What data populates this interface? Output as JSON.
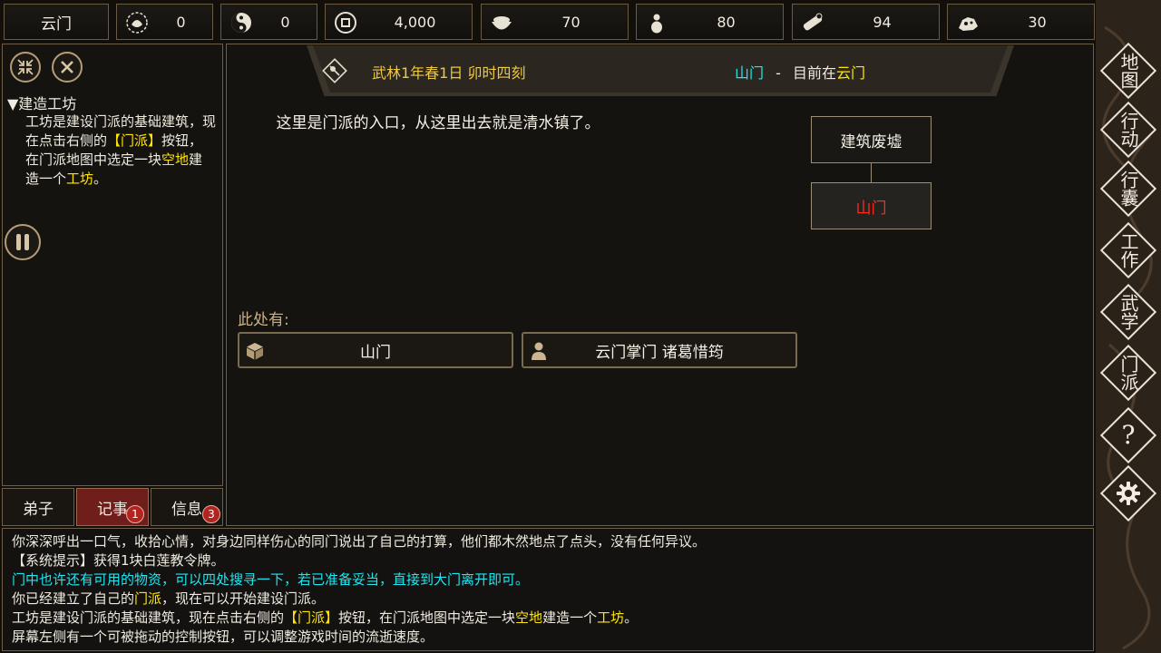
{
  "topbar": {
    "location_name": "云门",
    "resources": [
      {
        "icon": "reputation-icon",
        "value": "0"
      },
      {
        "icon": "yin-yang-icon",
        "value": "0"
      },
      {
        "icon": "coin-icon",
        "value": "4,000"
      },
      {
        "icon": "food-bowl-icon",
        "value": "70"
      },
      {
        "icon": "gourd-icon",
        "value": "80"
      },
      {
        "icon": "wood-log-icon",
        "value": "94"
      },
      {
        "icon": "ore-icon",
        "value": "30"
      }
    ]
  },
  "left_panel": {
    "quest_title": "▼建造工坊",
    "quest_text_parts": [
      "工坊是建设门派的基础建筑，现在点击右侧的",
      "【门派】",
      "按钮，在门派地图中选定一块",
      "空地",
      "建造一个",
      "工坊",
      "。"
    ],
    "tabs": [
      {
        "label": "弟子",
        "badge": ""
      },
      {
        "label": "记事",
        "badge": "1"
      },
      {
        "label": "信息",
        "badge": "3"
      }
    ]
  },
  "header": {
    "date": "武林1年春1日 卯时四刻",
    "place": "山门",
    "separator": "-",
    "current_prefix": "目前在",
    "current_location": "云门"
  },
  "main": {
    "description": "这里是门派的入口，从这里出去就是清水镇了。",
    "map_nodes": [
      {
        "label": "建筑废墟",
        "color": "#f5f0e6"
      },
      {
        "label": "山门",
        "color": "#ff2a1f"
      }
    ],
    "here_label": "此处有:",
    "objects": [
      {
        "icon": "box-icon",
        "label": "山门"
      },
      {
        "icon": "person-icon",
        "label": "云门掌门 诸葛惜筠"
      }
    ]
  },
  "right_nav": [
    {
      "label": "地图",
      "icon": ""
    },
    {
      "label": "行动",
      "icon": ""
    },
    {
      "label": "行囊",
      "icon": ""
    },
    {
      "label": "工作",
      "icon": ""
    },
    {
      "label": "武学",
      "icon": ""
    },
    {
      "label": "门派",
      "icon": ""
    },
    {
      "label": "?",
      "icon": "help-icon"
    },
    {
      "label": "",
      "icon": "gear-icon"
    }
  ],
  "log": {
    "line1": "你深深呼出一口气，收拾心情，对身边同样伤心的同门说出了自己的打算，他们都木然地点了点头，没有任何异议。",
    "line2": "【系统提示】获得1块白莲教令牌。",
    "line3": "门中也许还有可用的物资，可以四处搜寻一下，若已准备妥当，直接到大门离开即可。",
    "line4_parts": [
      "你已经建立了自己的",
      "门派",
      "，现在可以开始建设门派。"
    ],
    "line5_parts": [
      "工坊是建设门派的基础建筑，现在点击右侧的",
      "【门派】",
      "按钮，在门派地图中选定一块",
      "空地",
      "建造一个",
      "工坊",
      "。"
    ],
    "line6": "屏幕左侧有一个可被拖动的控制按钮，可以调整游戏时间的流逝速度。"
  },
  "colors": {
    "highlight_yellow": "#ffe600",
    "highlight_cyan": "#1fe6f0",
    "accent_red": "#ff2a1f",
    "tab_active": "#6f1e1b"
  }
}
